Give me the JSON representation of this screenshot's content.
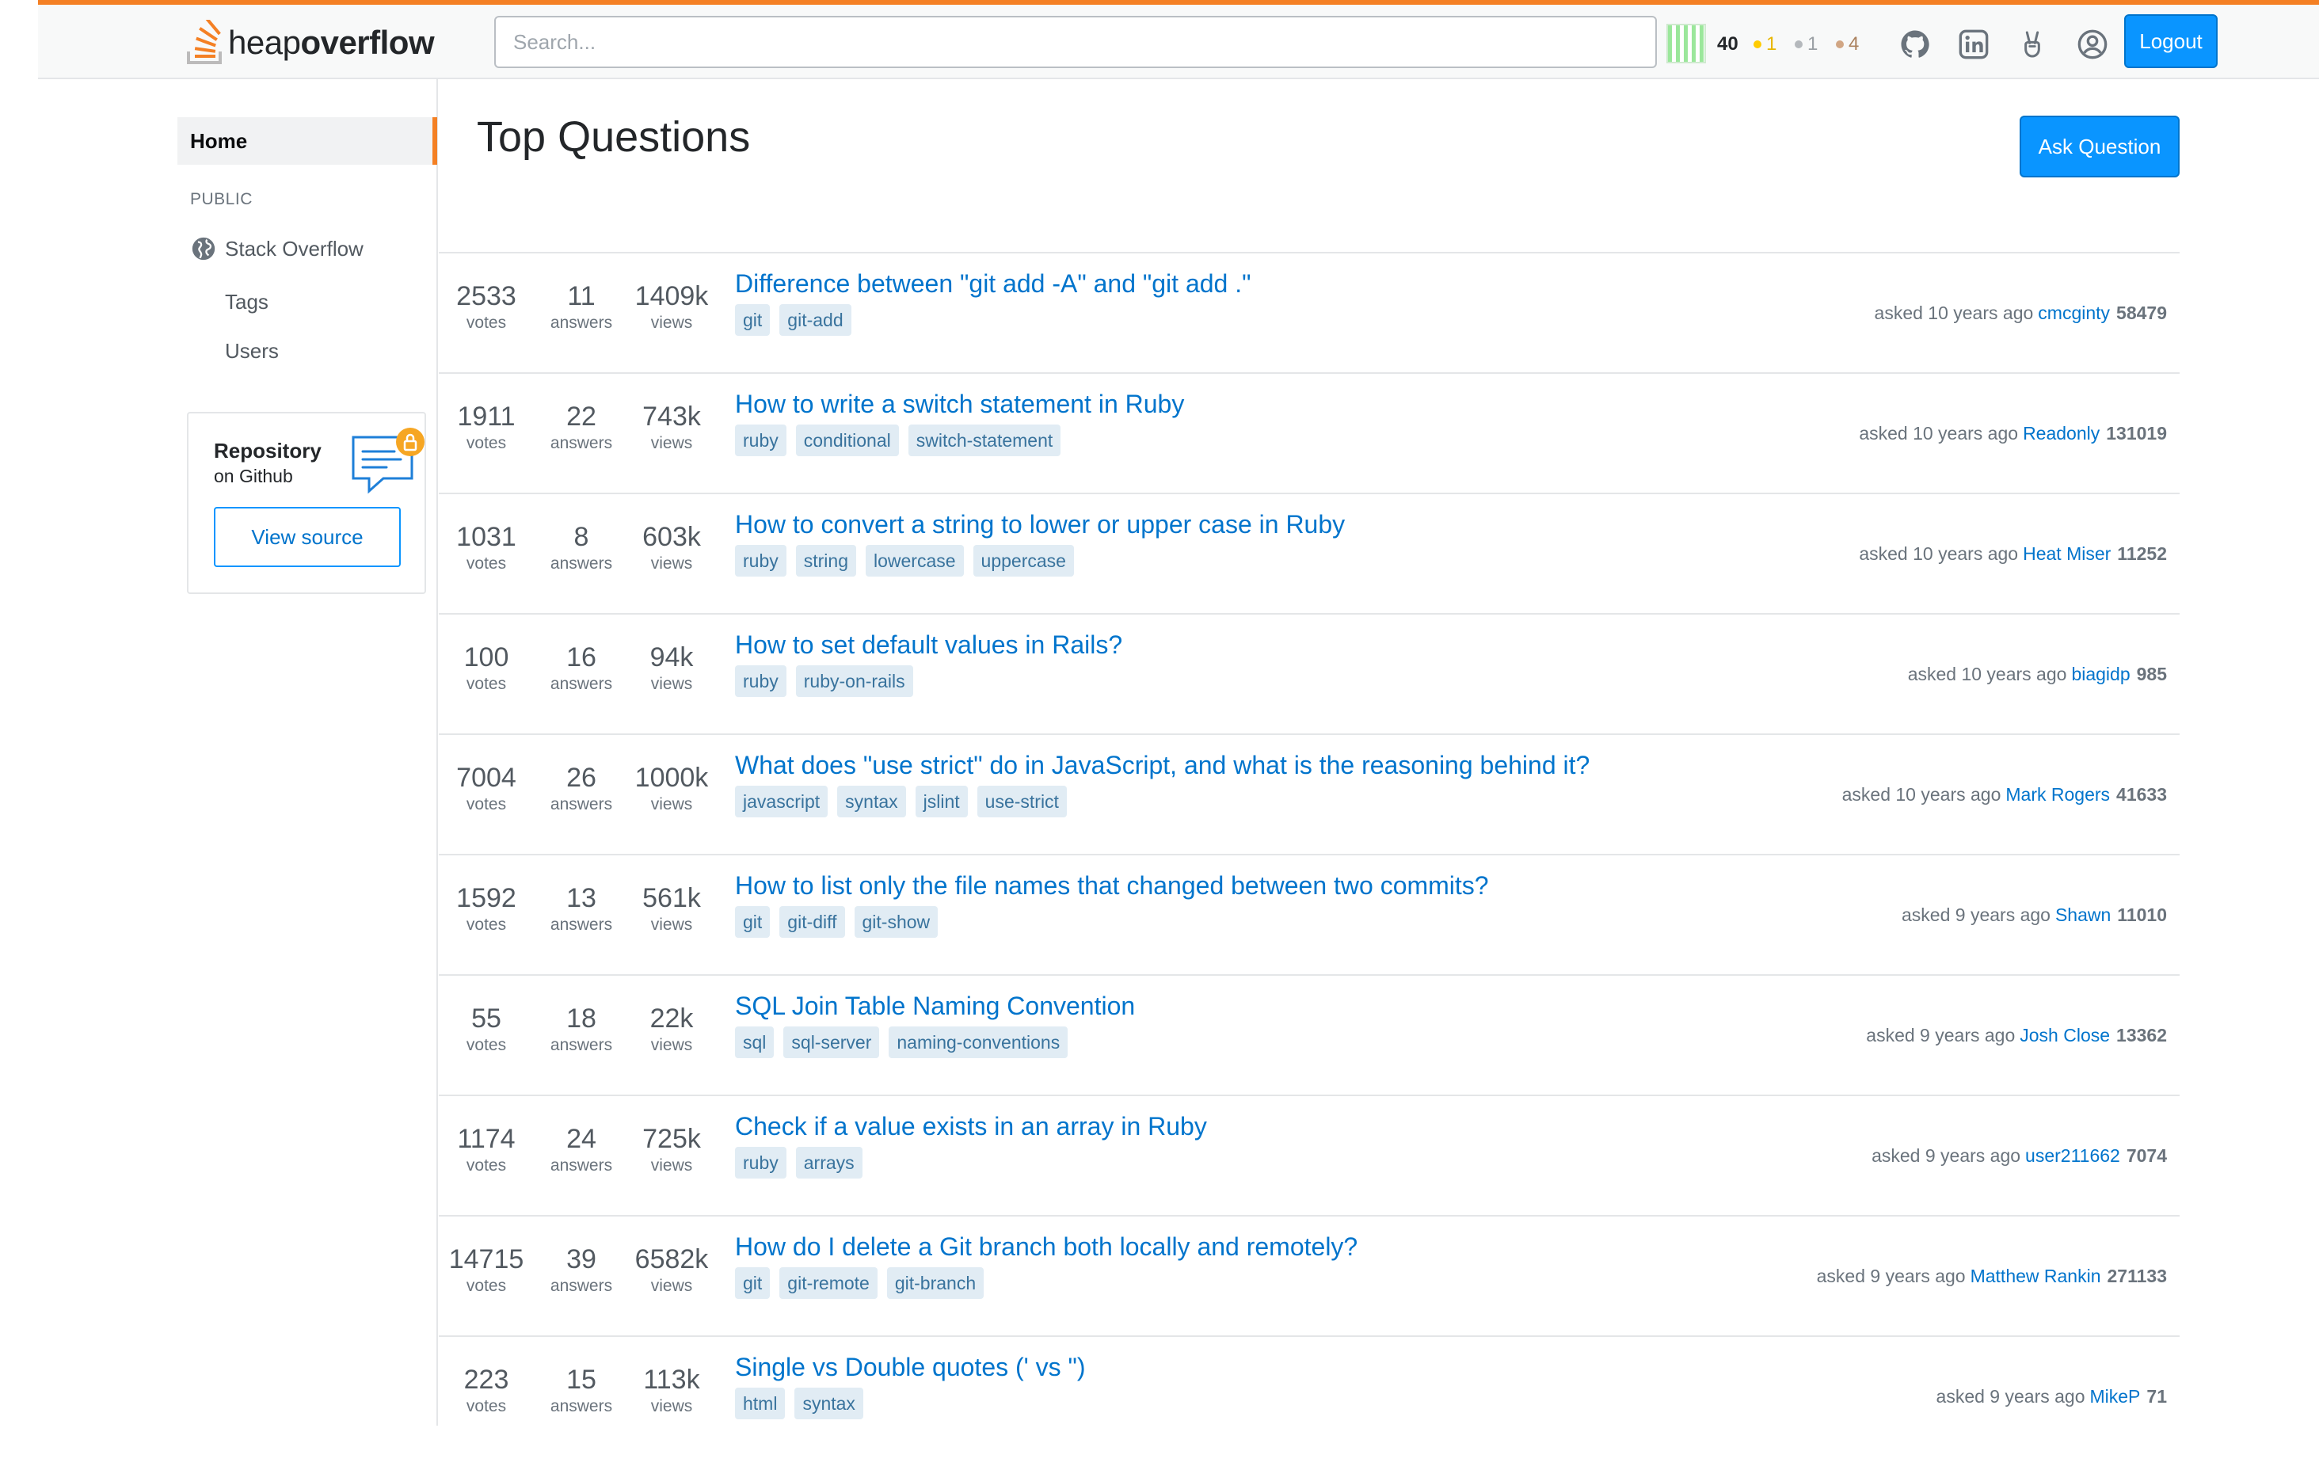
{
  "header": {
    "logo_light": "heap",
    "logo_bold": "overflow",
    "search_placeholder": "Search...",
    "reputation": "40",
    "badges": {
      "gold": "1",
      "silver": "1",
      "bronze": "4"
    },
    "logout_label": "Logout",
    "icons": [
      "github-icon",
      "linkedin-icon",
      "peace-hand-icon",
      "user-profile-icon"
    ]
  },
  "sidebar": {
    "home": "Home",
    "section": "PUBLIC",
    "stack_overflow": "Stack Overflow",
    "tags": "Tags",
    "users": "Users",
    "repo": {
      "title": "Repository",
      "subtitle": "on Github",
      "button": "View source"
    }
  },
  "main": {
    "title": "Top Questions",
    "ask_label": "Ask Question",
    "labels": {
      "votes": "votes",
      "answers": "answers",
      "views": "views"
    },
    "questions": [
      {
        "votes": "2533",
        "answers": "11",
        "views": "1409k",
        "title": "Difference between \"git add -A\" and \"git add .\"",
        "tags": [
          "git",
          "git-add"
        ],
        "asked": "asked 10 years ago",
        "user": "cmcginty",
        "rep": "58479"
      },
      {
        "votes": "1911",
        "answers": "22",
        "views": "743k",
        "title": "How to write a switch statement in Ruby",
        "tags": [
          "ruby",
          "conditional",
          "switch-statement"
        ],
        "asked": "asked 10 years ago",
        "user": "Readonly",
        "rep": "131019"
      },
      {
        "votes": "1031",
        "answers": "8",
        "views": "603k",
        "title": "How to convert a string to lower or upper case in Ruby",
        "tags": [
          "ruby",
          "string",
          "lowercase",
          "uppercase"
        ],
        "asked": "asked 10 years ago",
        "user": "Heat Miser",
        "rep": "11252"
      },
      {
        "votes": "100",
        "answers": "16",
        "views": "94k",
        "title": "How to set default values in Rails?",
        "tags": [
          "ruby",
          "ruby-on-rails"
        ],
        "asked": "asked 10 years ago",
        "user": "biagidp",
        "rep": "985"
      },
      {
        "votes": "7004",
        "answers": "26",
        "views": "1000k",
        "title": "What does \"use strict\" do in JavaScript, and what is the reasoning behind it?",
        "tags": [
          "javascript",
          "syntax",
          "jslint",
          "use-strict"
        ],
        "asked": "asked 10 years ago",
        "user": "Mark Rogers",
        "rep": "41633"
      },
      {
        "votes": "1592",
        "answers": "13",
        "views": "561k",
        "title": "How to list only the file names that changed between two commits?",
        "tags": [
          "git",
          "git-diff",
          "git-show"
        ],
        "asked": "asked 9 years ago",
        "user": "Shawn",
        "rep": "11010"
      },
      {
        "votes": "55",
        "answers": "18",
        "views": "22k",
        "title": "SQL Join Table Naming Convention",
        "tags": [
          "sql",
          "sql-server",
          "naming-conventions"
        ],
        "asked": "asked 9 years ago",
        "user": "Josh Close",
        "rep": "13362"
      },
      {
        "votes": "1174",
        "answers": "24",
        "views": "725k",
        "title": "Check if a value exists in an array in Ruby",
        "tags": [
          "ruby",
          "arrays"
        ],
        "asked": "asked 9 years ago",
        "user": "user211662",
        "rep": "7074"
      },
      {
        "votes": "14715",
        "answers": "39",
        "views": "6582k",
        "title": "How do I delete a Git branch both locally and remotely?",
        "tags": [
          "git",
          "git-remote",
          "git-branch"
        ],
        "asked": "asked 9 years ago",
        "user": "Matthew Rankin",
        "rep": "271133"
      },
      {
        "votes": "223",
        "answers": "15",
        "views": "113k",
        "title": "Single vs Double quotes (' vs \")",
        "tags": [
          "html",
          "syntax"
        ],
        "asked": "asked 9 years ago",
        "user": "MikeP",
        "rep": "71"
      }
    ]
  },
  "colors": {
    "accent_orange": "#f48024",
    "primary_blue": "#0a95ff",
    "link_blue": "#0074cc",
    "tag_bg": "#e1ecf4",
    "tag_text": "#39739d"
  }
}
